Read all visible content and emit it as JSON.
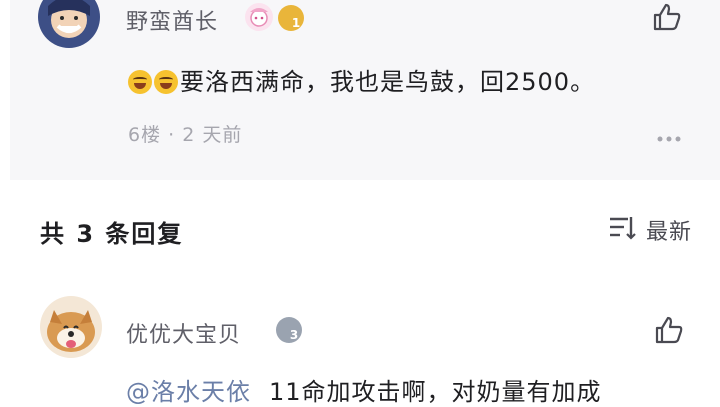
{
  "post": {
    "username": "野蛮酋长",
    "level_badge": "1",
    "message_text": "要洛西满命，我也是鸟鼓，回2500。",
    "emoji_names": [
      "laughing-tears-emoji",
      "laughing-tears-emoji"
    ],
    "floor": "6楼",
    "separator": "·",
    "time": "2 天前"
  },
  "replies_header": {
    "title": "共 3 条回复",
    "sort_label": "最新"
  },
  "reply": {
    "username": "优优大宝贝",
    "level_badge": "3",
    "mention": "@洛水天依",
    "text": "11命加攻击啊，对奶量有加成"
  },
  "colors": {
    "card_bg": "#f7f7f9",
    "mention": "#6b7fa8",
    "gold_badge": "#e9b53a",
    "silver_badge": "#9aa3b0"
  },
  "icons": [
    "thumbs-up-icon",
    "more-options-icon",
    "sort-list-icon"
  ]
}
